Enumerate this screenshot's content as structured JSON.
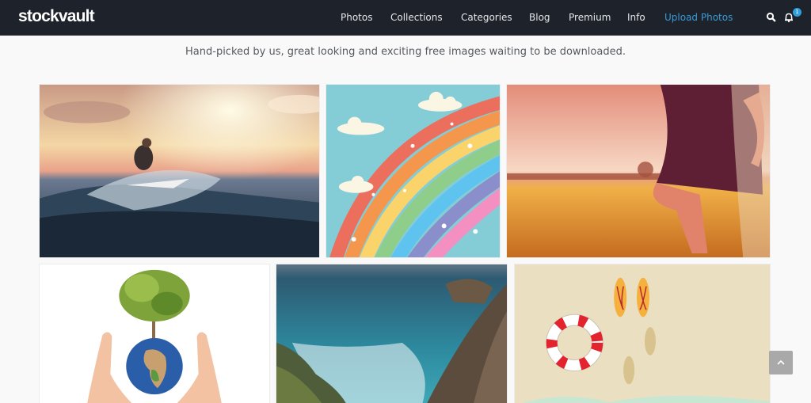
{
  "brand": {
    "logo_text": "stockvault"
  },
  "nav": {
    "items": [
      {
        "label": "Photos"
      },
      {
        "label": "Collections"
      },
      {
        "label": "Categories"
      },
      {
        "label": "Blog"
      },
      {
        "label": "Premium"
      },
      {
        "label": "Info"
      },
      {
        "label": "Upload Photos",
        "accent": true
      }
    ],
    "search_icon": "search-icon",
    "notifications": {
      "icon": "bell-icon",
      "count": "1"
    }
  },
  "hero": {
    "tagline": "Hand-picked by us, great looking and exciting free images waiting to be downloaded."
  },
  "gallery": {
    "images": [
      {
        "subject": "surfer riding a wave at sunset"
      },
      {
        "subject": "rainbow with clouds illustration"
      },
      {
        "subject": "woman in polka dot dress in wheat field"
      },
      {
        "subject": "hands holding globe with tree"
      },
      {
        "subject": "rocky ocean coastline"
      },
      {
        "subject": "beach with life ring, flip flops and footprints"
      }
    ]
  },
  "scroll_top": {
    "icon": "chevron-up-icon"
  },
  "colors": {
    "navbar_bg": "#1e232b",
    "accent": "#3a9ad9",
    "badge": "#2f9fe0",
    "page_bg": "#f9f9f9"
  }
}
